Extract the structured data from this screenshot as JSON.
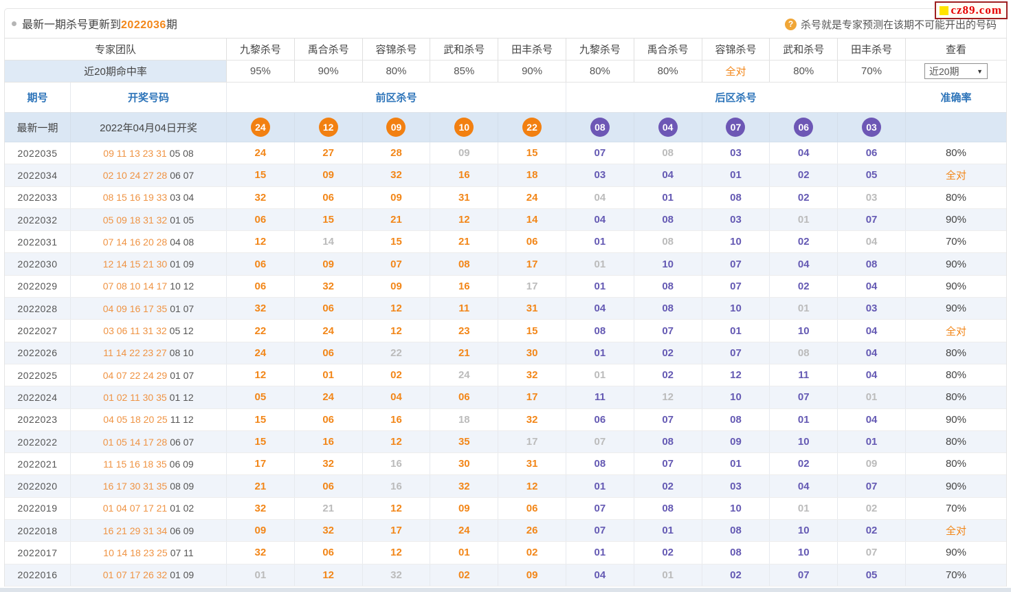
{
  "page": {
    "title_prefix": "最新一期杀号更新到",
    "title_issue": "2022036",
    "title_suffix": "期",
    "logo_text": "cz89.com",
    "help_icon": "?",
    "help_text": "杀号就是专家预测在该期不可能开出的号码"
  },
  "colors": {
    "accent_orange": "#f28618",
    "ball_orange": "#f28011",
    "ball_purple": "#6d57b5",
    "kill_purple": "#6459b3",
    "miss_gray": "#bbbbbb",
    "header_blue": "#2d74b9",
    "latest_row_bg": "#dbe7f4",
    "stripe_bg": "#f0f4fa",
    "logo_red": "#e60000"
  },
  "table": {
    "expert_team_label": "专家团队",
    "experts": [
      "九黎杀号",
      "禹合杀号",
      "容锦杀号",
      "武和杀号",
      "田丰杀号",
      "九黎杀号",
      "禹合杀号",
      "容锦杀号",
      "武和杀号",
      "田丰杀号"
    ],
    "view_label": "查看",
    "hit_rate_label": "近20期命中率",
    "hit_rates": [
      "95%",
      "90%",
      "80%",
      "85%",
      "90%",
      "80%",
      "80%",
      "全对",
      "80%",
      "70%"
    ],
    "dropdown_value": "近20期",
    "dropdown_arrow": "▼",
    "issue_header": "期号",
    "draw_header": "开奖号码",
    "front_kill_header": "前区杀号",
    "back_kill_header": "后区杀号",
    "accuracy_header": "准确率",
    "latest": {
      "label": "最新一期",
      "draw_date": "2022年04月04日开奖",
      "front_balls": [
        "24",
        "12",
        "09",
        "10",
        "22"
      ],
      "back_balls": [
        "08",
        "04",
        "07",
        "06",
        "03"
      ]
    },
    "rows": [
      {
        "issue": "2022035",
        "front_draw": "09 11 13 23 31",
        "back_draw": "05 08",
        "front_kills": [
          [
            "24",
            1
          ],
          [
            "27",
            1
          ],
          [
            "28",
            1
          ],
          [
            "09",
            0
          ],
          [
            "15",
            1
          ]
        ],
        "back_kills": [
          [
            "07",
            1
          ],
          [
            "08",
            0
          ],
          [
            "03",
            1
          ],
          [
            "04",
            1
          ],
          [
            "06",
            1
          ]
        ],
        "accuracy": "80%"
      },
      {
        "issue": "2022034",
        "front_draw": "02 10 24 27 28",
        "back_draw": "06 07",
        "front_kills": [
          [
            "15",
            1
          ],
          [
            "09",
            1
          ],
          [
            "32",
            1
          ],
          [
            "16",
            1
          ],
          [
            "18",
            1
          ]
        ],
        "back_kills": [
          [
            "03",
            1
          ],
          [
            "04",
            1
          ],
          [
            "01",
            1
          ],
          [
            "02",
            1
          ],
          [
            "05",
            1
          ]
        ],
        "accuracy": "全对"
      },
      {
        "issue": "2022033",
        "front_draw": "08 15 16 19 33",
        "back_draw": "03 04",
        "front_kills": [
          [
            "32",
            1
          ],
          [
            "06",
            1
          ],
          [
            "09",
            1
          ],
          [
            "31",
            1
          ],
          [
            "24",
            1
          ]
        ],
        "back_kills": [
          [
            "04",
            0
          ],
          [
            "01",
            1
          ],
          [
            "08",
            1
          ],
          [
            "02",
            1
          ],
          [
            "03",
            0
          ]
        ],
        "accuracy": "80%"
      },
      {
        "issue": "2022032",
        "front_draw": "05 09 18 31 32",
        "back_draw": "01 05",
        "front_kills": [
          [
            "06",
            1
          ],
          [
            "15",
            1
          ],
          [
            "21",
            1
          ],
          [
            "12",
            1
          ],
          [
            "14",
            1
          ]
        ],
        "back_kills": [
          [
            "04",
            1
          ],
          [
            "08",
            1
          ],
          [
            "03",
            1
          ],
          [
            "01",
            0
          ],
          [
            "07",
            1
          ]
        ],
        "accuracy": "90%"
      },
      {
        "issue": "2022031",
        "front_draw": "07 14 16 20 28",
        "back_draw": "04 08",
        "front_kills": [
          [
            "12",
            1
          ],
          [
            "14",
            0
          ],
          [
            "15",
            1
          ],
          [
            "21",
            1
          ],
          [
            "06",
            1
          ]
        ],
        "back_kills": [
          [
            "01",
            1
          ],
          [
            "08",
            0
          ],
          [
            "10",
            1
          ],
          [
            "02",
            1
          ],
          [
            "04",
            0
          ]
        ],
        "accuracy": "70%"
      },
      {
        "issue": "2022030",
        "front_draw": "12 14 15 21 30",
        "back_draw": "01 09",
        "front_kills": [
          [
            "06",
            1
          ],
          [
            "09",
            1
          ],
          [
            "07",
            1
          ],
          [
            "08",
            1
          ],
          [
            "17",
            1
          ]
        ],
        "back_kills": [
          [
            "01",
            0
          ],
          [
            "10",
            1
          ],
          [
            "07",
            1
          ],
          [
            "04",
            1
          ],
          [
            "08",
            1
          ]
        ],
        "accuracy": "90%"
      },
      {
        "issue": "2022029",
        "front_draw": "07 08 10 14 17",
        "back_draw": "10 12",
        "front_kills": [
          [
            "06",
            1
          ],
          [
            "32",
            1
          ],
          [
            "09",
            1
          ],
          [
            "16",
            1
          ],
          [
            "17",
            0
          ]
        ],
        "back_kills": [
          [
            "01",
            1
          ],
          [
            "08",
            1
          ],
          [
            "07",
            1
          ],
          [
            "02",
            1
          ],
          [
            "04",
            1
          ]
        ],
        "accuracy": "90%"
      },
      {
        "issue": "2022028",
        "front_draw": "04 09 16 17 35",
        "back_draw": "01 07",
        "front_kills": [
          [
            "32",
            1
          ],
          [
            "06",
            1
          ],
          [
            "12",
            1
          ],
          [
            "11",
            1
          ],
          [
            "31",
            1
          ]
        ],
        "back_kills": [
          [
            "04",
            1
          ],
          [
            "08",
            1
          ],
          [
            "10",
            1
          ],
          [
            "01",
            0
          ],
          [
            "03",
            1
          ]
        ],
        "accuracy": "90%"
      },
      {
        "issue": "2022027",
        "front_draw": "03 06 11 31 32",
        "back_draw": "05 12",
        "front_kills": [
          [
            "22",
            1
          ],
          [
            "24",
            1
          ],
          [
            "12",
            1
          ],
          [
            "23",
            1
          ],
          [
            "15",
            1
          ]
        ],
        "back_kills": [
          [
            "08",
            1
          ],
          [
            "07",
            1
          ],
          [
            "01",
            1
          ],
          [
            "10",
            1
          ],
          [
            "04",
            1
          ]
        ],
        "accuracy": "全对"
      },
      {
        "issue": "2022026",
        "front_draw": "11 14 22 23 27",
        "back_draw": "08 10",
        "front_kills": [
          [
            "24",
            1
          ],
          [
            "06",
            1
          ],
          [
            "22",
            0
          ],
          [
            "21",
            1
          ],
          [
            "30",
            1
          ]
        ],
        "back_kills": [
          [
            "01",
            1
          ],
          [
            "02",
            1
          ],
          [
            "07",
            1
          ],
          [
            "08",
            0
          ],
          [
            "04",
            1
          ]
        ],
        "accuracy": "80%"
      },
      {
        "issue": "2022025",
        "front_draw": "04 07 22 24 29",
        "back_draw": "01 07",
        "front_kills": [
          [
            "12",
            1
          ],
          [
            "01",
            1
          ],
          [
            "02",
            1
          ],
          [
            "24",
            0
          ],
          [
            "32",
            1
          ]
        ],
        "back_kills": [
          [
            "01",
            0
          ],
          [
            "02",
            1
          ],
          [
            "12",
            1
          ],
          [
            "11",
            1
          ],
          [
            "04",
            1
          ]
        ],
        "accuracy": "80%"
      },
      {
        "issue": "2022024",
        "front_draw": "01 02 11 30 35",
        "back_draw": "01 12",
        "front_kills": [
          [
            "05",
            1
          ],
          [
            "24",
            1
          ],
          [
            "04",
            1
          ],
          [
            "06",
            1
          ],
          [
            "17",
            1
          ]
        ],
        "back_kills": [
          [
            "11",
            1
          ],
          [
            "12",
            0
          ],
          [
            "10",
            1
          ],
          [
            "07",
            1
          ],
          [
            "01",
            0
          ]
        ],
        "accuracy": "80%"
      },
      {
        "issue": "2022023",
        "front_draw": "04 05 18 20 25",
        "back_draw": "11 12",
        "front_kills": [
          [
            "15",
            1
          ],
          [
            "06",
            1
          ],
          [
            "16",
            1
          ],
          [
            "18",
            0
          ],
          [
            "32",
            1
          ]
        ],
        "back_kills": [
          [
            "06",
            1
          ],
          [
            "07",
            1
          ],
          [
            "08",
            1
          ],
          [
            "01",
            1
          ],
          [
            "04",
            1
          ]
        ],
        "accuracy": "90%"
      },
      {
        "issue": "2022022",
        "front_draw": "01 05 14 17 28",
        "back_draw": "06 07",
        "front_kills": [
          [
            "15",
            1
          ],
          [
            "16",
            1
          ],
          [
            "12",
            1
          ],
          [
            "35",
            1
          ],
          [
            "17",
            0
          ]
        ],
        "back_kills": [
          [
            "07",
            0
          ],
          [
            "08",
            1
          ],
          [
            "09",
            1
          ],
          [
            "10",
            1
          ],
          [
            "01",
            1
          ]
        ],
        "accuracy": "80%"
      },
      {
        "issue": "2022021",
        "front_draw": "11 15 16 18 35",
        "back_draw": "06 09",
        "front_kills": [
          [
            "17",
            1
          ],
          [
            "32",
            1
          ],
          [
            "16",
            0
          ],
          [
            "30",
            1
          ],
          [
            "31",
            1
          ]
        ],
        "back_kills": [
          [
            "08",
            1
          ],
          [
            "07",
            1
          ],
          [
            "01",
            1
          ],
          [
            "02",
            1
          ],
          [
            "09",
            0
          ]
        ],
        "accuracy": "80%"
      },
      {
        "issue": "2022020",
        "front_draw": "16 17 30 31 35",
        "back_draw": "08 09",
        "front_kills": [
          [
            "21",
            1
          ],
          [
            "06",
            1
          ],
          [
            "16",
            0
          ],
          [
            "32",
            1
          ],
          [
            "12",
            1
          ]
        ],
        "back_kills": [
          [
            "01",
            1
          ],
          [
            "02",
            1
          ],
          [
            "03",
            1
          ],
          [
            "04",
            1
          ],
          [
            "07",
            1
          ]
        ],
        "accuracy": "90%"
      },
      {
        "issue": "2022019",
        "front_draw": "01 04 07 17 21",
        "back_draw": "01 02",
        "front_kills": [
          [
            "32",
            1
          ],
          [
            "21",
            0
          ],
          [
            "12",
            1
          ],
          [
            "09",
            1
          ],
          [
            "06",
            1
          ]
        ],
        "back_kills": [
          [
            "07",
            1
          ],
          [
            "08",
            1
          ],
          [
            "10",
            1
          ],
          [
            "01",
            0
          ],
          [
            "02",
            0
          ]
        ],
        "accuracy": "70%"
      },
      {
        "issue": "2022018",
        "front_draw": "16 21 29 31 34",
        "back_draw": "06 09",
        "front_kills": [
          [
            "09",
            1
          ],
          [
            "32",
            1
          ],
          [
            "17",
            1
          ],
          [
            "24",
            1
          ],
          [
            "26",
            1
          ]
        ],
        "back_kills": [
          [
            "07",
            1
          ],
          [
            "01",
            1
          ],
          [
            "08",
            1
          ],
          [
            "10",
            1
          ],
          [
            "02",
            1
          ]
        ],
        "accuracy": "全对"
      },
      {
        "issue": "2022017",
        "front_draw": "10 14 18 23 25",
        "back_draw": "07 11",
        "front_kills": [
          [
            "32",
            1
          ],
          [
            "06",
            1
          ],
          [
            "12",
            1
          ],
          [
            "01",
            1
          ],
          [
            "02",
            1
          ]
        ],
        "back_kills": [
          [
            "01",
            1
          ],
          [
            "02",
            1
          ],
          [
            "08",
            1
          ],
          [
            "10",
            1
          ],
          [
            "07",
            0
          ]
        ],
        "accuracy": "90%"
      },
      {
        "issue": "2022016",
        "front_draw": "01 07 17 26 32",
        "back_draw": "01 09",
        "front_kills": [
          [
            "01",
            0
          ],
          [
            "12",
            1
          ],
          [
            "32",
            0
          ],
          [
            "02",
            1
          ],
          [
            "09",
            1
          ]
        ],
        "back_kills": [
          [
            "04",
            1
          ],
          [
            "01",
            0
          ],
          [
            "02",
            1
          ],
          [
            "07",
            1
          ],
          [
            "05",
            1
          ]
        ],
        "accuracy": "70%"
      }
    ]
  }
}
